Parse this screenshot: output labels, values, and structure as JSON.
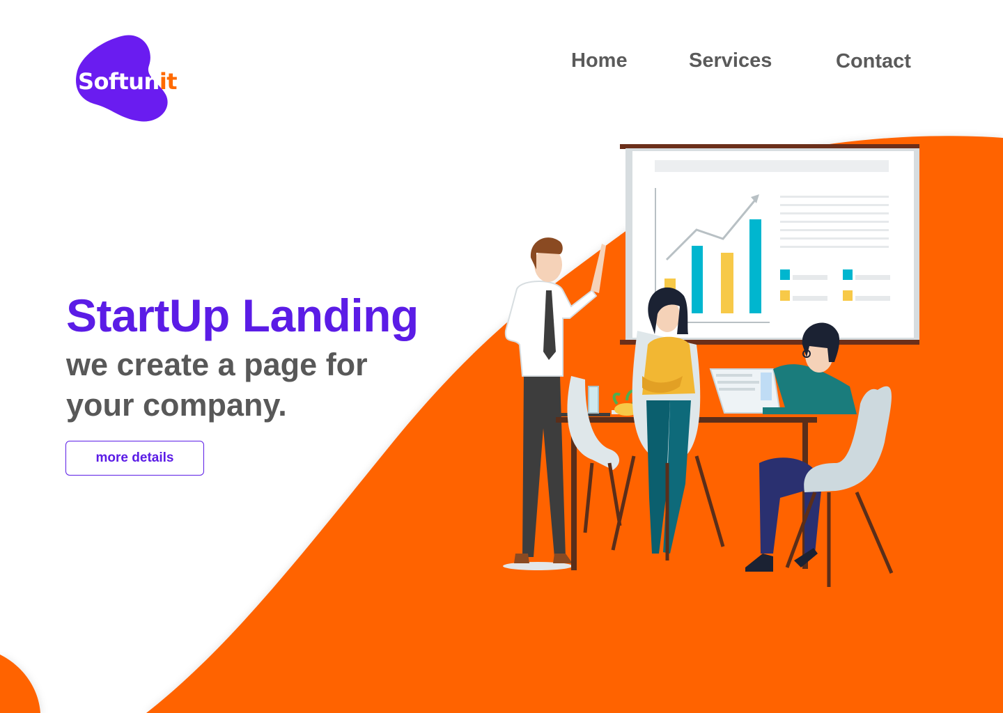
{
  "brand": {
    "logo_main": "Softun",
    "logo_accent": "it",
    "colors": {
      "primary": "#5b1ce6",
      "accent": "#ff6a00",
      "text_dark": "#585858",
      "background": "#ffffff"
    }
  },
  "nav": {
    "items": [
      {
        "label": "Home"
      },
      {
        "label": "Services"
      },
      {
        "label": "Contact"
      }
    ]
  },
  "hero": {
    "title": "StartUp Landing",
    "subtitle": "we create a page for your company.",
    "cta_label": "more details"
  },
  "illustration": {
    "description_icon": "team-meeting-illustration",
    "board_chart": {
      "type": "bar",
      "values": [
        55,
        70,
        55,
        90
      ]
    }
  }
}
